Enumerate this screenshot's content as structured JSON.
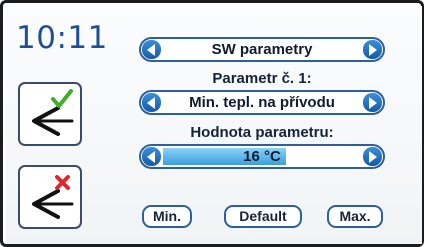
{
  "clock": "10:11",
  "menu": {
    "selected": "SW parametry"
  },
  "parameter": {
    "label": "Parametr č. 1:",
    "selected": "Min. tepl. na přívodu"
  },
  "value": {
    "label": "Hodnota parametru:",
    "text": "16 °C",
    "level": 0.62
  },
  "buttons": {
    "min": "Min.",
    "default": "Default",
    "max": "Max."
  },
  "icons": {
    "confirm": "back-arrow-with-green-check-icon",
    "cancel": "back-arrow-with-red-x-icon"
  },
  "colors": {
    "accent": "#155aa6",
    "clock": "#1f4f97",
    "check": "#3fae2a",
    "cross": "#e0262f"
  }
}
